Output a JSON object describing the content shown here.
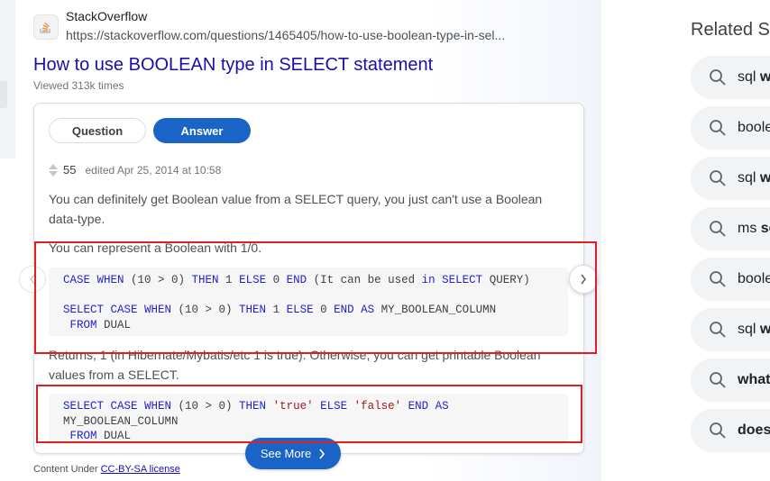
{
  "result": {
    "site_name": "StackOverflow",
    "url": "https://stackoverflow.com/questions/1465405/how-to-use-boolean-type-in-sel...",
    "title": "How to use BOOLEAN type in SELECT statement",
    "viewed": "Viewed 313k times"
  },
  "tabs": {
    "question": "Question",
    "answer": "Answer"
  },
  "answer": {
    "votes": "55",
    "edited": "edited Apr 25, 2014 at 10:58",
    "text1": "You can definitely get Boolean value from a SELECT query, you just can't use a Boolean data-type.",
    "text2": "You can represent a Boolean with 1/0.",
    "text3": "Returns, 1 (in Hibernate/Mybatis/etc 1 is true). Otherwise, you can get printable Boolean values from a SELECT."
  },
  "see_more": "See More",
  "license": {
    "prefix": "Content Under",
    "link": "CC-BY-SA license"
  },
  "related": {
    "title": "Related Se",
    "items": [
      {
        "pre": "sql",
        "bold": "w"
      },
      {
        "pre": "boole",
        "bold": ""
      },
      {
        "pre": "sql",
        "bold": "w"
      },
      {
        "pre": "ms",
        "bold": "se"
      },
      {
        "pre": "boole",
        "bold": ""
      },
      {
        "pre": "sql",
        "bold": "w"
      },
      {
        "pre": "",
        "bold": "what"
      },
      {
        "pre": "",
        "bold": "does"
      }
    ]
  },
  "colors": {
    "accent": "#1a64c8",
    "title_link": "#1a0dab",
    "highlight": "#e02020"
  }
}
